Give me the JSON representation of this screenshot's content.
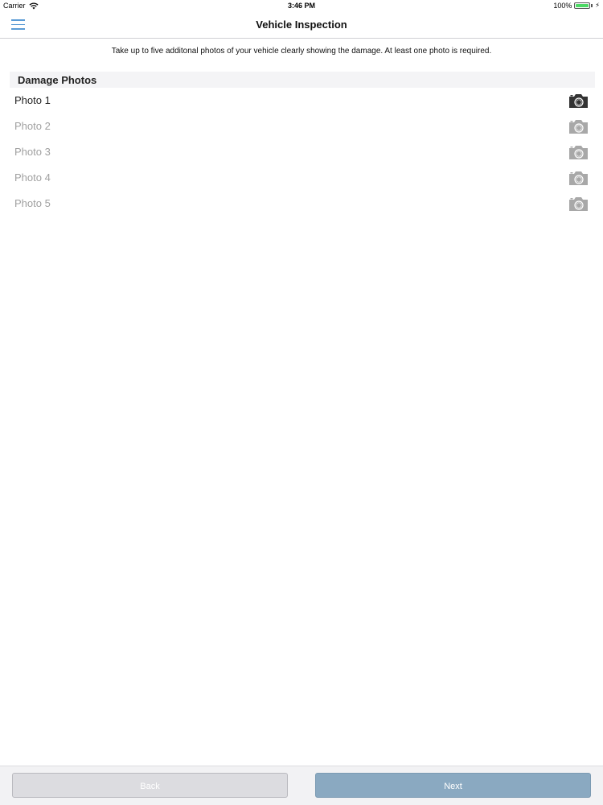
{
  "status_bar": {
    "carrier": "Carrier",
    "time": "3:46 PM",
    "battery_percent": "100%",
    "battery_level": 1.0,
    "battery_color": "#4cd964"
  },
  "nav": {
    "title": "Vehicle Inspection",
    "menu_icon": "hamburger-menu-icon",
    "accent_color": "#5b9bd5"
  },
  "instruction": "Take up to five additonal photos of your vehicle clearly showing the damage. At least one photo is required.",
  "section": {
    "title": "Damage Photos"
  },
  "photos": [
    {
      "label": "Photo 1",
      "active": true,
      "icon": "camera-icon"
    },
    {
      "label": "Photo 2",
      "active": false,
      "icon": "camera-icon"
    },
    {
      "label": "Photo 3",
      "active": false,
      "icon": "camera-icon"
    },
    {
      "label": "Photo 4",
      "active": false,
      "icon": "camera-icon"
    },
    {
      "label": "Photo 5",
      "active": false,
      "icon": "camera-icon"
    }
  ],
  "toolbar": {
    "back_label": "Back",
    "next_label": "Next"
  }
}
